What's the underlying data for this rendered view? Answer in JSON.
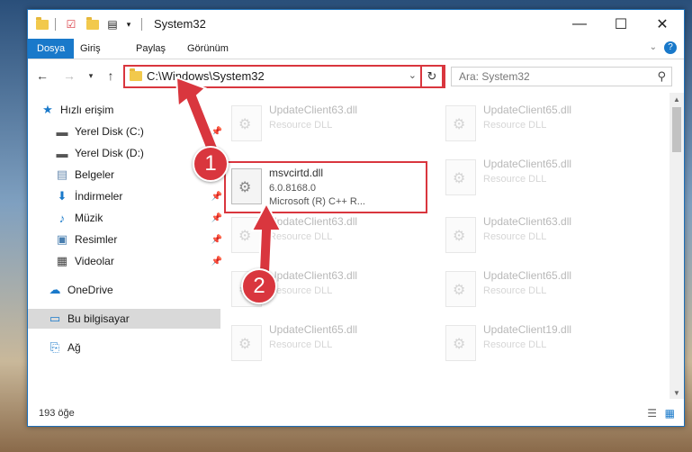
{
  "window": {
    "title": "System32",
    "controls": {
      "minimize": "—",
      "maximize": "☐",
      "close": "✕"
    }
  },
  "ribbon": {
    "tabs": [
      "Dosya",
      "Giriş",
      "Paylaş",
      "Görünüm"
    ]
  },
  "address": {
    "path": "C:\\Windows\\System32"
  },
  "search": {
    "placeholder": "Ara: System32"
  },
  "sidebar": {
    "items": [
      {
        "label": "Hızlı erişim",
        "icon": "star-icon"
      },
      {
        "label": "Yerel Disk (C:)",
        "icon": "drive-icon"
      },
      {
        "label": "Yerel Disk (D:)",
        "icon": "drive-icon"
      },
      {
        "label": "Belgeler",
        "icon": "documents-icon"
      },
      {
        "label": "İndirmeler",
        "icon": "download-icon"
      },
      {
        "label": "Müzik",
        "icon": "music-icon"
      },
      {
        "label": "Resimler",
        "icon": "pictures-icon"
      },
      {
        "label": "Videolar",
        "icon": "video-icon"
      },
      {
        "label": "OneDrive",
        "icon": "cloud-icon"
      },
      {
        "label": "Bu bilgisayar",
        "icon": "computer-icon"
      },
      {
        "label": "Ağ",
        "icon": "network-icon"
      }
    ]
  },
  "files": {
    "highlighted": {
      "name": "msvcirtd.dll",
      "version": "6.0.8168.0",
      "company": "Microsoft (R) C++ R..."
    },
    "others": [
      {
        "name": "UpdateClient63.dll",
        "desc": "Resource DLL"
      },
      {
        "name": "UpdateClient65.dll",
        "desc": "Resource DLL"
      },
      {
        "name": "UpdateClient65.dll",
        "desc": "Resource DLL"
      },
      {
        "name": "UpdateClient63.dll",
        "desc": "Resource DLL"
      },
      {
        "name": "UpdateClient63.dll",
        "desc": "Resource DLL"
      },
      {
        "name": "UpdateClient63.dll",
        "desc": "Resource DLL"
      },
      {
        "name": "UpdateClient65.dll",
        "desc": "Resource DLL"
      },
      {
        "name": "UpdateClient65.dll",
        "desc": "Resource DLL"
      },
      {
        "name": "UpdateClient19.dll",
        "desc": "Resource DLL"
      }
    ]
  },
  "status": {
    "count": "193 öğe"
  },
  "annotations": {
    "badge1": "1",
    "badge2": "2"
  },
  "colors": {
    "accent": "#1979ca",
    "highlight": "#d9363e"
  }
}
